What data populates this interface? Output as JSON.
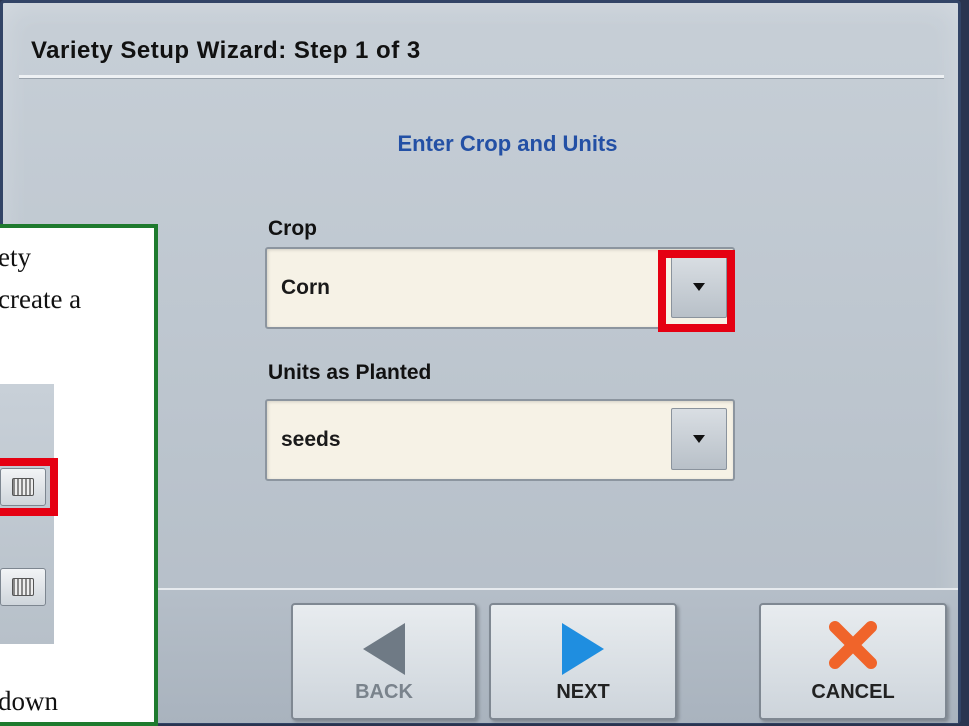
{
  "wizard": {
    "title": "Variety Setup Wizard:  Step 1 of 3",
    "subtitle": "Enter Crop and Units"
  },
  "crop": {
    "label": "Crop",
    "value": "Corn",
    "dropdown_icon": "chevron-down-icon"
  },
  "units": {
    "label": "Units as Planted",
    "value": "seeds",
    "dropdown_icon": "chevron-down-icon"
  },
  "buttons": {
    "back": "BACK",
    "next": "NEXT",
    "cancel": "CANCEL"
  },
  "callout": {
    "line1": "ety",
    "line2": "create a",
    "line3": "down",
    "icons": [
      "keyboard-icon",
      "keyboard-icon"
    ]
  },
  "colors": {
    "title_rule": "#eef1f4",
    "subtitle": "#2350a5",
    "highlight": "#e50012",
    "callout_border": "#1e7a2e",
    "back_arrow": "#6f7a85",
    "next_arrow": "#1f8ee0",
    "cancel_x": "#f0642a"
  }
}
